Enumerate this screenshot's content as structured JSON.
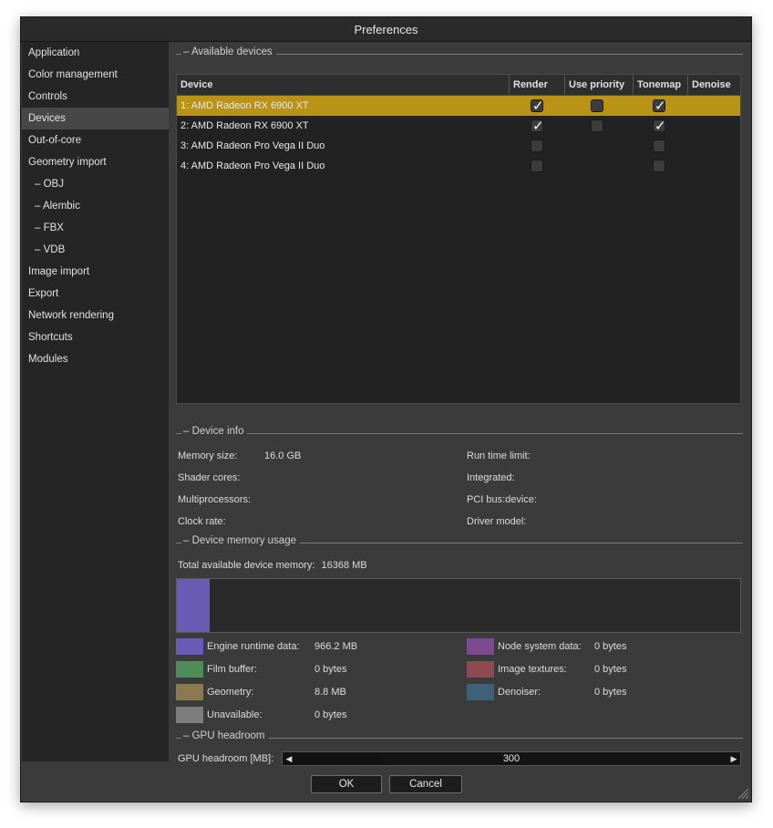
{
  "window": {
    "title": "Preferences"
  },
  "sidebar": {
    "items": [
      {
        "label": "Application"
      },
      {
        "label": "Color management"
      },
      {
        "label": "Controls"
      },
      {
        "label": "Devices"
      },
      {
        "label": "Out-of-core"
      },
      {
        "label": "Geometry import"
      },
      {
        "label": "–  OBJ"
      },
      {
        "label": "–  Alembic"
      },
      {
        "label": "–  FBX"
      },
      {
        "label": "–  VDB"
      },
      {
        "label": "Image import"
      },
      {
        "label": "Export"
      },
      {
        "label": "Network rendering"
      },
      {
        "label": "Shortcuts"
      },
      {
        "label": "Modules"
      }
    ],
    "active_index": 3
  },
  "devices": {
    "section_label": "Available devices",
    "columns": [
      "Device",
      "Render",
      "Use priority",
      "Tonemap",
      "Denoise"
    ],
    "rows": [
      {
        "name": "1: AMD Radeon RX 6900 XT",
        "render": true,
        "use_priority": false,
        "tonemap": true,
        "selected": true
      },
      {
        "name": "2: AMD Radeon RX 6900 XT",
        "render": true,
        "use_priority": false,
        "tonemap": true,
        "selected": false
      },
      {
        "name": "3: AMD Radeon Pro Vega II Duo",
        "render": false,
        "use_priority": null,
        "tonemap": false,
        "selected": false
      },
      {
        "name": "4: AMD Radeon Pro Vega II Duo",
        "render": false,
        "use_priority": null,
        "tonemap": false,
        "selected": false
      }
    ],
    "selection_color": "#b99316"
  },
  "device_info": {
    "section_label": "Device info",
    "memory_size_label": "Memory size:",
    "memory_size_value": "16.0 GB",
    "shader_cores_label": "Shader cores:",
    "multiprocessors_label": "Multiprocessors:",
    "clock_rate_label": "Clock rate:",
    "run_time_limit_label": "Run time limit:",
    "integrated_label": "Integrated:",
    "pci_bus_label": "PCI bus:device:",
    "driver_model_label": "Driver model:"
  },
  "memory_usage": {
    "section_label": "Device memory usage",
    "total_label": "Total available device memory:",
    "total_value": "16368 MB",
    "used_fraction": 0.059,
    "legend": [
      {
        "label": "Engine runtime data:",
        "value": "966.2 MB",
        "color": "#6a5bb5"
      },
      {
        "label": "Film buffer:",
        "value": "0 bytes",
        "color": "#4e8d5a"
      },
      {
        "label": "Geometry:",
        "value": "8.8 MB",
        "color": "#8a7a4e"
      },
      {
        "label": "Unavailable:",
        "value": "0 bytes",
        "color": "#7d7d7d"
      },
      {
        "label": "Node system data:",
        "value": "0 bytes",
        "color": "#7b4a8f"
      },
      {
        "label": "Image textures:",
        "value": "0 bytes",
        "color": "#8e4a52"
      },
      {
        "label": "Denoiser:",
        "value": "0 bytes",
        "color": "#3d6277"
      }
    ]
  },
  "gpu_headroom": {
    "section_label": "GPU headroom",
    "label": "GPU headroom [MB]:",
    "value": "300",
    "fill_fraction": 0.22
  },
  "buttons": {
    "ok": "OK",
    "cancel": "Cancel"
  }
}
